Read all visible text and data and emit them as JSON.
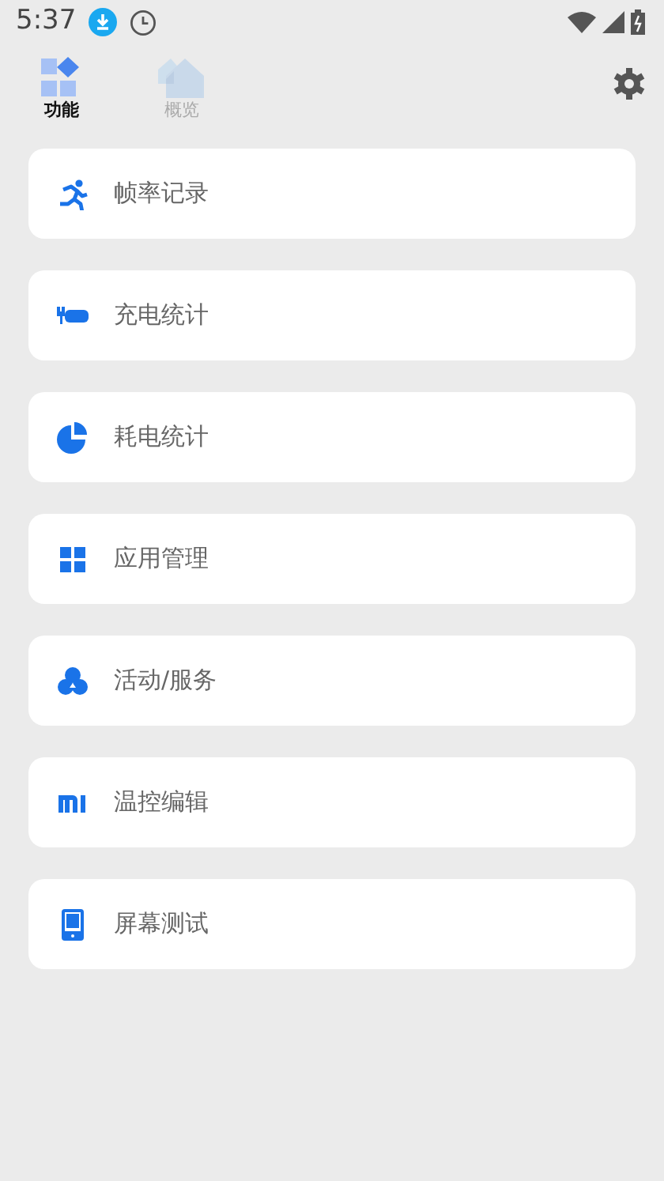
{
  "status_bar": {
    "time": "5:37"
  },
  "tabs": [
    {
      "label": "功能",
      "selected": true
    },
    {
      "label": "概览",
      "selected": false
    }
  ],
  "items": [
    {
      "label": "帧率记录"
    },
    {
      "label": "充电统计"
    },
    {
      "label": "耗电统计"
    },
    {
      "label": "应用管理"
    },
    {
      "label": "活动/服务"
    },
    {
      "label": "温控编辑"
    },
    {
      "label": "屏幕测试"
    }
  ]
}
